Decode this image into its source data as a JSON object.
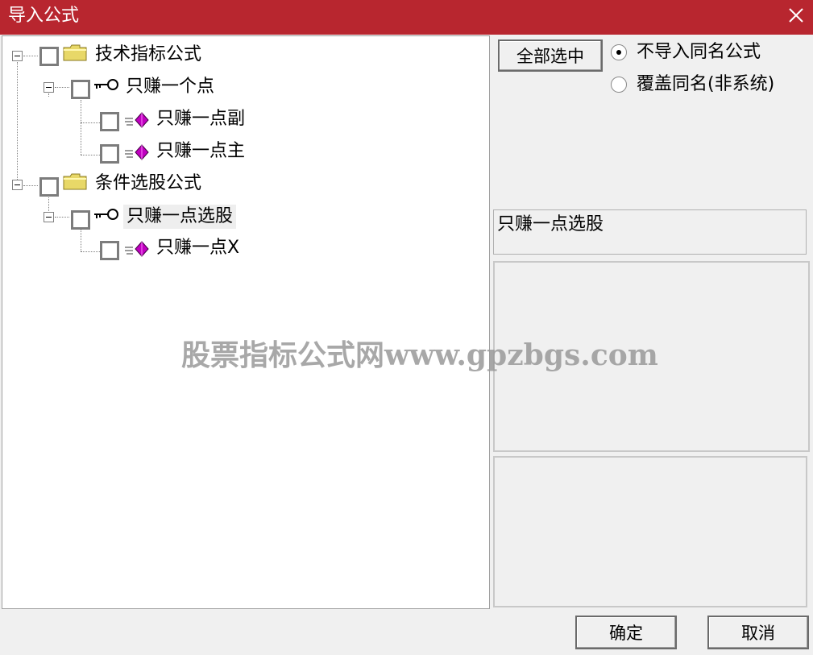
{
  "window": {
    "title": "导入公式",
    "close_icon": "close-icon"
  },
  "tree": [
    {
      "label": "技术指标公式",
      "icon": "folder-icon",
      "level": 0
    },
    {
      "label": "只赚一个点",
      "icon": "key-icon",
      "level": 1
    },
    {
      "label": "只赚一点副",
      "icon": "formula-icon",
      "level": 2
    },
    {
      "label": "只赚一点主",
      "icon": "formula-icon",
      "level": 2
    },
    {
      "label": "条件选股公式",
      "icon": "folder-icon",
      "level": 0
    },
    {
      "label": "只赚一点选股",
      "icon": "key-icon",
      "level": 1,
      "selected": true
    },
    {
      "label": "只赚一点X",
      "icon": "formula-icon",
      "level": 2
    }
  ],
  "buttons": {
    "select_all": "全部选中",
    "ok": "确定",
    "cancel": "取消"
  },
  "options": [
    {
      "label": "不导入同名公式",
      "checked": true
    },
    {
      "label": "覆盖同名(非系统)",
      "checked": false
    }
  ],
  "formula_name": "只赚一点选股",
  "description": "",
  "params": "",
  "watermark": "股票指标公式网www.gpzbgs.com",
  "colors": {
    "titlebar": "#b8262f",
    "diamond": "#c000c0",
    "folder": "#f0e070"
  }
}
